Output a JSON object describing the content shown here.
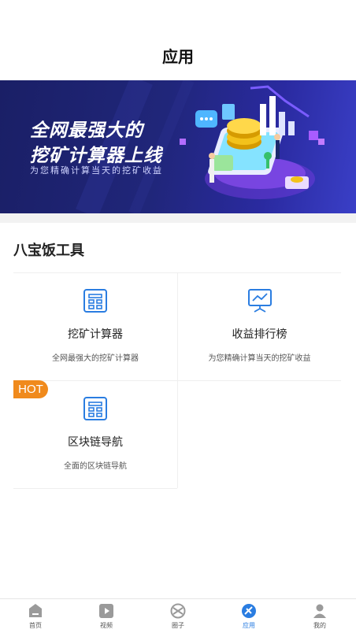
{
  "header": {
    "title": "应用"
  },
  "banner": {
    "title_line1": "全网最强大的",
    "title_line2": "挖矿计算器上线",
    "subtitle": "为您精确计算当天的挖矿收益"
  },
  "section": {
    "title": "八宝饭工具"
  },
  "tools": [
    {
      "name": "挖矿计算器",
      "desc": "全网最强大的挖矿计算器",
      "icon": "calculator-icon"
    },
    {
      "name": "收益排行榜",
      "desc": "为您精确计算当天的挖矿收益",
      "icon": "chart-board-icon"
    },
    {
      "name": "区块链导航",
      "desc": "全面的区块链导航",
      "icon": "calculator-icon",
      "badge": "HOT"
    }
  ],
  "tabbar": {
    "items": [
      {
        "label": "首页",
        "icon": "home-icon"
      },
      {
        "label": "视频",
        "icon": "video-icon"
      },
      {
        "label": "圈子",
        "icon": "circle-icon"
      },
      {
        "label": "应用",
        "icon": "app-icon",
        "active": true
      },
      {
        "label": "我的",
        "icon": "profile-icon"
      }
    ]
  },
  "colors": {
    "accent": "#2a7de1",
    "badge": "#f08a1c",
    "banner": "#1a1f66"
  }
}
